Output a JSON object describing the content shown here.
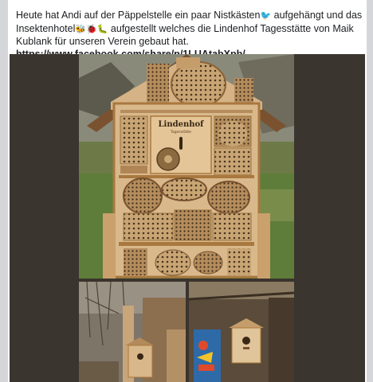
{
  "post": {
    "text_part1": "Heute hat Andi auf der Päppelstelle ein paar Nistkästen",
    "text_part2": " aufgehängt und das Insektenhotel",
    "text_part3": " aufgestellt welches die Lindenhof Tagesstätte von Maik Kublank für unseren Verein gebaut hat. ",
    "link": "https://www.facebook.com/share/p/1LUAtabXpb/",
    "emoji_1": "bird-emoji",
    "emoji_2": "insects-emoji"
  },
  "photo": {
    "sign_text": "Lindenhof",
    "sign_subtext": "Tagesstätte"
  },
  "colors": {
    "wood_light": "#d9b98c",
    "wood_dark": "#a9783f",
    "grass": "#5e7d3a",
    "background_dark": "#3b352f"
  }
}
